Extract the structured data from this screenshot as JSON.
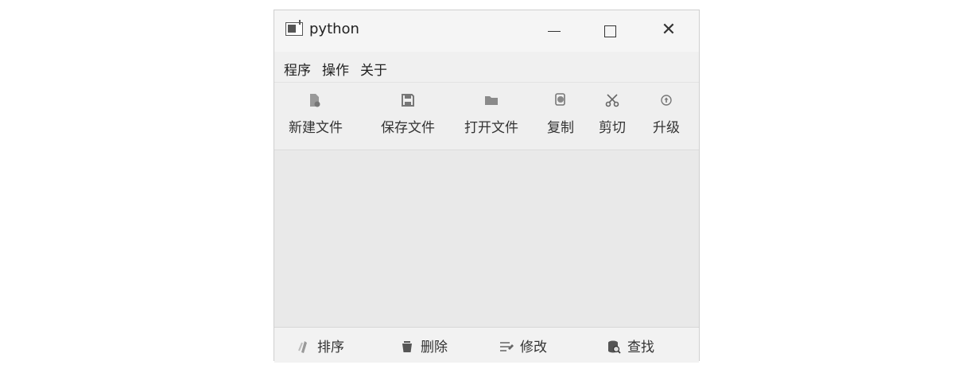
{
  "window": {
    "title": "python",
    "controls": {
      "minimize_glyph": "—",
      "maximize_glyph": "☐",
      "close_glyph": "✕"
    }
  },
  "menubar": {
    "items": [
      {
        "label": "程序"
      },
      {
        "label": "操作"
      },
      {
        "label": "关于"
      }
    ]
  },
  "toolbar": {
    "items": [
      {
        "label": "新建文件",
        "icon": "new-file-icon"
      },
      {
        "label": "保存文件",
        "icon": "save-icon"
      },
      {
        "label": "打开文件",
        "icon": "folder-open-icon"
      },
      {
        "label": "复制",
        "icon": "copy-icon"
      },
      {
        "label": "剪切",
        "icon": "scissors-icon"
      },
      {
        "label": "升级",
        "icon": "upgrade-icon"
      }
    ]
  },
  "bottombar": {
    "items": [
      {
        "label": "排序",
        "icon": "sort-icon"
      },
      {
        "label": "删除",
        "icon": "trash-icon"
      },
      {
        "label": "修改",
        "icon": "edit-icon"
      },
      {
        "label": "查找",
        "icon": "search-database-icon"
      }
    ]
  },
  "colors": {
    "window_bg": "#f3f3f3",
    "content_bg": "#e9e9e9",
    "icon_gray": "#888888"
  }
}
